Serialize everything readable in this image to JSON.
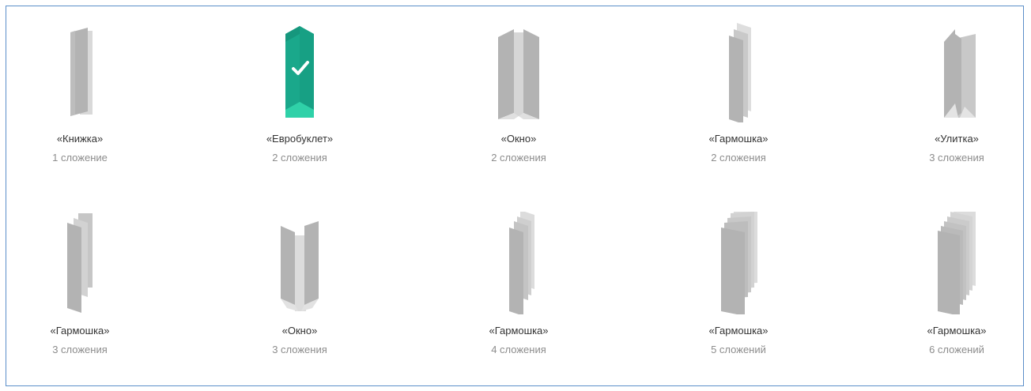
{
  "colors": {
    "selected": "#1aa88b",
    "selected_light": "#2ec8a3",
    "panel": "#b3b3b3",
    "panel_light": "#d0d0d0",
    "panel_lighter": "#dedede"
  },
  "options": [
    {
      "title": "«Книжка»",
      "subtitle": "1 сложение",
      "icon": "book-fold-icon",
      "selected": false
    },
    {
      "title": "«Евробуклет»",
      "subtitle": "2 сложения",
      "icon": "eurobooklet-fold-icon",
      "selected": true
    },
    {
      "title": "«Окно»",
      "subtitle": "2 сложения",
      "icon": "window-fold-icon",
      "selected": false
    },
    {
      "title": "«Гармошка»",
      "subtitle": "2 сложения",
      "icon": "accordion-fold-icon",
      "selected": false
    },
    {
      "title": "«Улитка»",
      "subtitle": "3 сложения",
      "icon": "roll-fold-icon",
      "selected": false
    },
    {
      "title": "«Гармошка»",
      "subtitle": "3 сложения",
      "icon": "accordion-fold-icon",
      "selected": false
    },
    {
      "title": "«Окно»",
      "subtitle": "3 сложения",
      "icon": "window-fold-icon",
      "selected": false
    },
    {
      "title": "«Гармошка»",
      "subtitle": "4 сложения",
      "icon": "accordion-fold-icon",
      "selected": false
    },
    {
      "title": "«Гармошка»",
      "subtitle": "5 сложений",
      "icon": "accordion-fold-icon",
      "selected": false
    },
    {
      "title": "«Гармошка»",
      "subtitle": "6 сложений",
      "icon": "accordion-fold-icon",
      "selected": false
    }
  ]
}
